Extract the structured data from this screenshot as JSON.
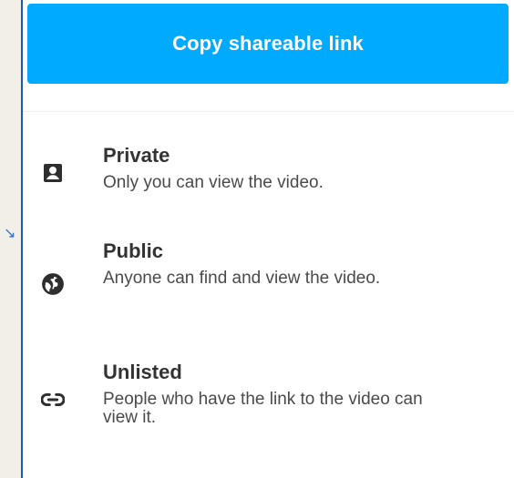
{
  "share": {
    "copy_link_label": "Copy shareable link"
  },
  "visibility_options": [
    {
      "title": "Private",
      "description": "Only you can view the video.",
      "icon": "person-badge-icon"
    },
    {
      "title": "Public",
      "description": "Anyone can find and view the video.",
      "icon": "globe-icon"
    },
    {
      "title": "Unlisted",
      "description": "People who have the link to the video can view it.",
      "icon": "link-icon"
    }
  ],
  "colors": {
    "button_blue": "#00aaff",
    "panel_border": "#1f56b0",
    "background": "#f1efe8"
  }
}
